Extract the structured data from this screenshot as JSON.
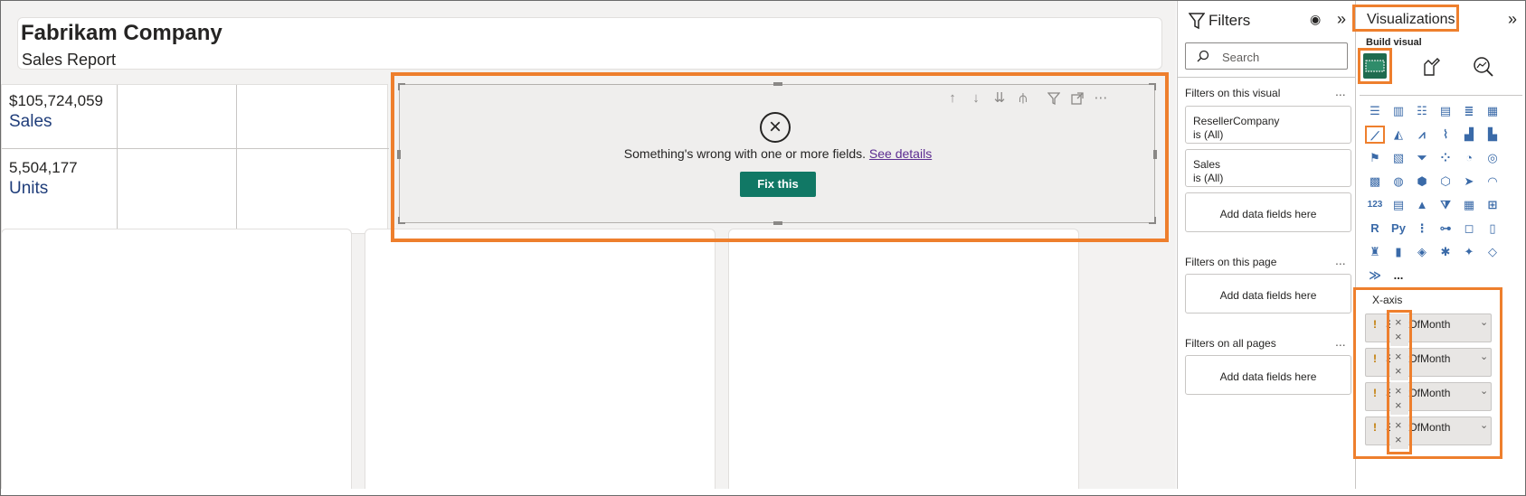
{
  "report": {
    "company": "Fabrikam Company",
    "subtitle": "Sales Report"
  },
  "kpis": [
    {
      "value": "$105,724,059",
      "label": "Sales"
    },
    {
      "value": "5,504,177",
      "label": "Units"
    }
  ],
  "error_visual": {
    "message": "Something's wrong with one or more fields.",
    "details_link": "See details",
    "fix_button": "Fix this"
  },
  "filters": {
    "title": "Filters",
    "search_placeholder": "Search",
    "on_visual_heading": "Filters on this visual",
    "on_visual_cards": [
      {
        "field": "ResellerCompany",
        "state": "is (All)"
      },
      {
        "field": "Sales",
        "state": "is (All)"
      }
    ],
    "add_fields": "Add data fields here",
    "on_page_heading": "Filters on this page",
    "on_all_pages_heading": "Filters on all pages",
    "more": "..."
  },
  "visualizations": {
    "title": "Visualizations",
    "build_visual": "Build visual",
    "more": "...",
    "x_axis_label": "X-axis",
    "x_axis_fields": [
      "StartOfMonth",
      "StartOfMonth",
      "StartOfMonth",
      "StartOfMonth"
    ]
  },
  "colors": {
    "highlight": "#ee7f2d",
    "fix_button": "#117865",
    "kpi_label": "#1f3d7a",
    "link": "#5c2d91"
  }
}
